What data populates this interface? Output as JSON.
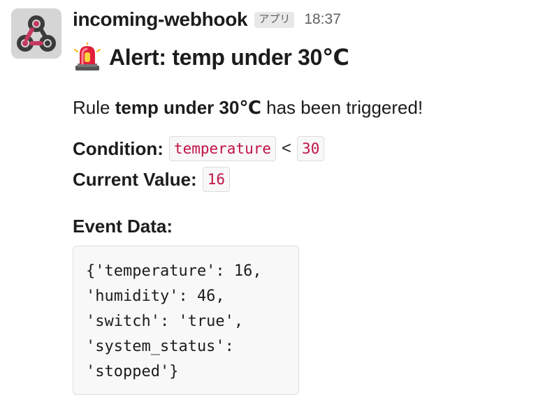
{
  "message": {
    "sender": "incoming-webhook",
    "app_badge": "アプリ",
    "timestamp": "18:37",
    "avatar_icon": "webhook-icon",
    "title_icon": "rotating-light-icon",
    "title": "Alert: temp under 30℃",
    "rule": {
      "prefix": "Rule ",
      "name": "temp under 30℃",
      "suffix": " has been triggered!"
    },
    "condition": {
      "label": "Condition:",
      "field": "temperature",
      "operator": "<",
      "threshold": "30"
    },
    "current": {
      "label": "Current Value:",
      "value": "16"
    },
    "event_data": {
      "label": "Event Data:",
      "lines": [
        "{'temperature': 16,",
        "'humidity': 46,",
        "'switch': 'true',",
        "'system_status':",
        "'stopped'}"
      ]
    }
  },
  "colors": {
    "inline_code": "#c01343",
    "avatar_bg": "#d5d5d5",
    "webhook_pink": "#c5385f",
    "webhook_dark": "#3b3b3b"
  }
}
